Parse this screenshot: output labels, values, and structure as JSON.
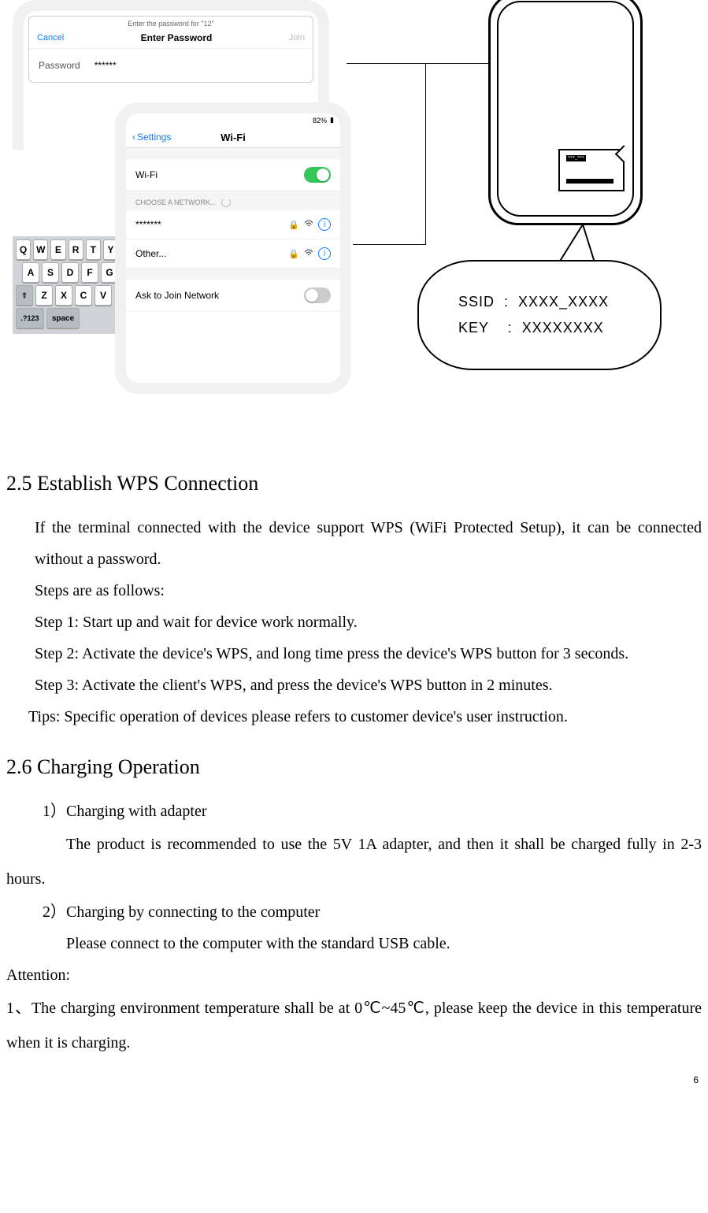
{
  "figure": {
    "password_dialog": {
      "hint": "Enter the password for \"12\"",
      "cancel": "Cancel",
      "title": "Enter Password",
      "join": "Join",
      "password_label": "Password",
      "password_value": "******"
    },
    "keyboard": {
      "row1": [
        "Q",
        "W",
        "E",
        "R",
        "T",
        "Y"
      ],
      "row2": [
        "A",
        "S",
        "D",
        "F",
        "G"
      ],
      "row3_shift": "⇧",
      "row3": [
        "Z",
        "X",
        "C",
        "V"
      ],
      "row4_num": ".?123",
      "row4_space": "space"
    },
    "wifi_settings": {
      "battery": "82%",
      "back_label": "Settings",
      "title": "Wi-Fi",
      "wifi_row": "Wi-Fi",
      "section": "CHOOSE A NETWORK...",
      "network": "*******",
      "other": "Other...",
      "ask": "Ask to Join Network"
    },
    "bubble": {
      "ssid_label": "SSID",
      "ssid_value": "XXXX_XXXX",
      "key_label": "KEY",
      "key_value": "XXXXXXXX"
    }
  },
  "section25": {
    "heading": "2.5 Establish WPS Connection",
    "p1": "If the terminal connected with the device support WPS (WiFi Protected Setup), it can be connected without a password.",
    "p2": "Steps are as follows:",
    "p3": "Step 1: Start up and wait for device work normally.",
    "p4": "Step 2: Activate the device's WPS, and long time press the device's WPS button for 3 seconds.",
    "p5": "Step 3: Activate the client's WPS, and press the device's WPS button in 2 minutes.",
    "p6": "Tips: Specific operation of devices please refers to customer device's user instruction."
  },
  "section26": {
    "heading": "2.6 Charging Operation",
    "item1": "1）Charging with adapter",
    "item1_body": "The product is recommended to use the 5V 1A adapter, and then it shall be charged fully in 2-3 hours.",
    "item2": "2）Charging by connecting to the computer",
    "item2_body": "Please connect to the computer with the standard USB cable.",
    "attention": "Attention:",
    "attn1": "1、The charging environment temperature shall be at 0℃~45℃, please keep the device in this temperature when it is charging."
  },
  "page_number": "6"
}
